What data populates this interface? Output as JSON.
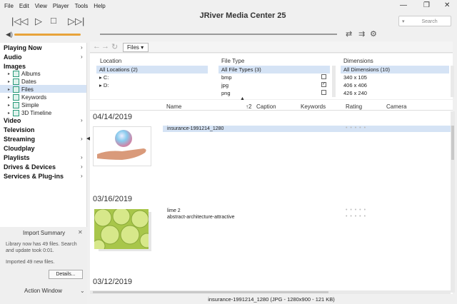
{
  "menu": [
    "File",
    "Edit",
    "View",
    "Player",
    "Tools",
    "Help"
  ],
  "app_title": "JRiver Media Center 25",
  "search_placeholder": "Search",
  "files_tab": "Files",
  "sidebar": {
    "playing_now": "Playing Now",
    "audio": "Audio",
    "images": "Images",
    "subs": [
      "Albums",
      "Dates",
      "Files",
      "Keywords",
      "Simple",
      "3D Timeline"
    ],
    "video": "Video",
    "television": "Television",
    "streaming": "Streaming",
    "cloudplay": "Cloudplay",
    "playlists": "Playlists",
    "drives": "Drives & Devices",
    "services": "Services & Plug-ins"
  },
  "summary": {
    "title": "Import Summary",
    "line1": "Library now has 49 files. Search and update took 0:01.",
    "line2": "Imported 49 new files.",
    "details_button": "Details...",
    "action_window": "Action Window"
  },
  "categories": {
    "location": {
      "title": "Location",
      "rows": [
        "All Locations (2)",
        "C:",
        "D:"
      ]
    },
    "filetype": {
      "title": "File Type",
      "rows": [
        "All File Types (3)",
        "bmp",
        "jpg",
        "png"
      ]
    },
    "dimensions": {
      "title": "Dimensions",
      "rows": [
        "All Dimensions (10)",
        "340 x 105",
        "406 x 406",
        "426 x 240"
      ]
    }
  },
  "columns": {
    "name": "Name",
    "sort": "↑2",
    "caption": "Caption",
    "keywords": "Keywords",
    "rating": "Rating",
    "camera": "Camera"
  },
  "groups": [
    {
      "date": "04/14/2019",
      "files": [
        "insurance-1991214_1280"
      ]
    },
    {
      "date": "03/16/2019",
      "files": [
        "lime 2",
        "abstract-architecture-attractive"
      ]
    },
    {
      "date": "03/12/2019",
      "files": []
    }
  ],
  "status_text": "insurance-1991214_1280 (JPG - 1280x900 - 121 KB)",
  "accent": "#e8a33a"
}
